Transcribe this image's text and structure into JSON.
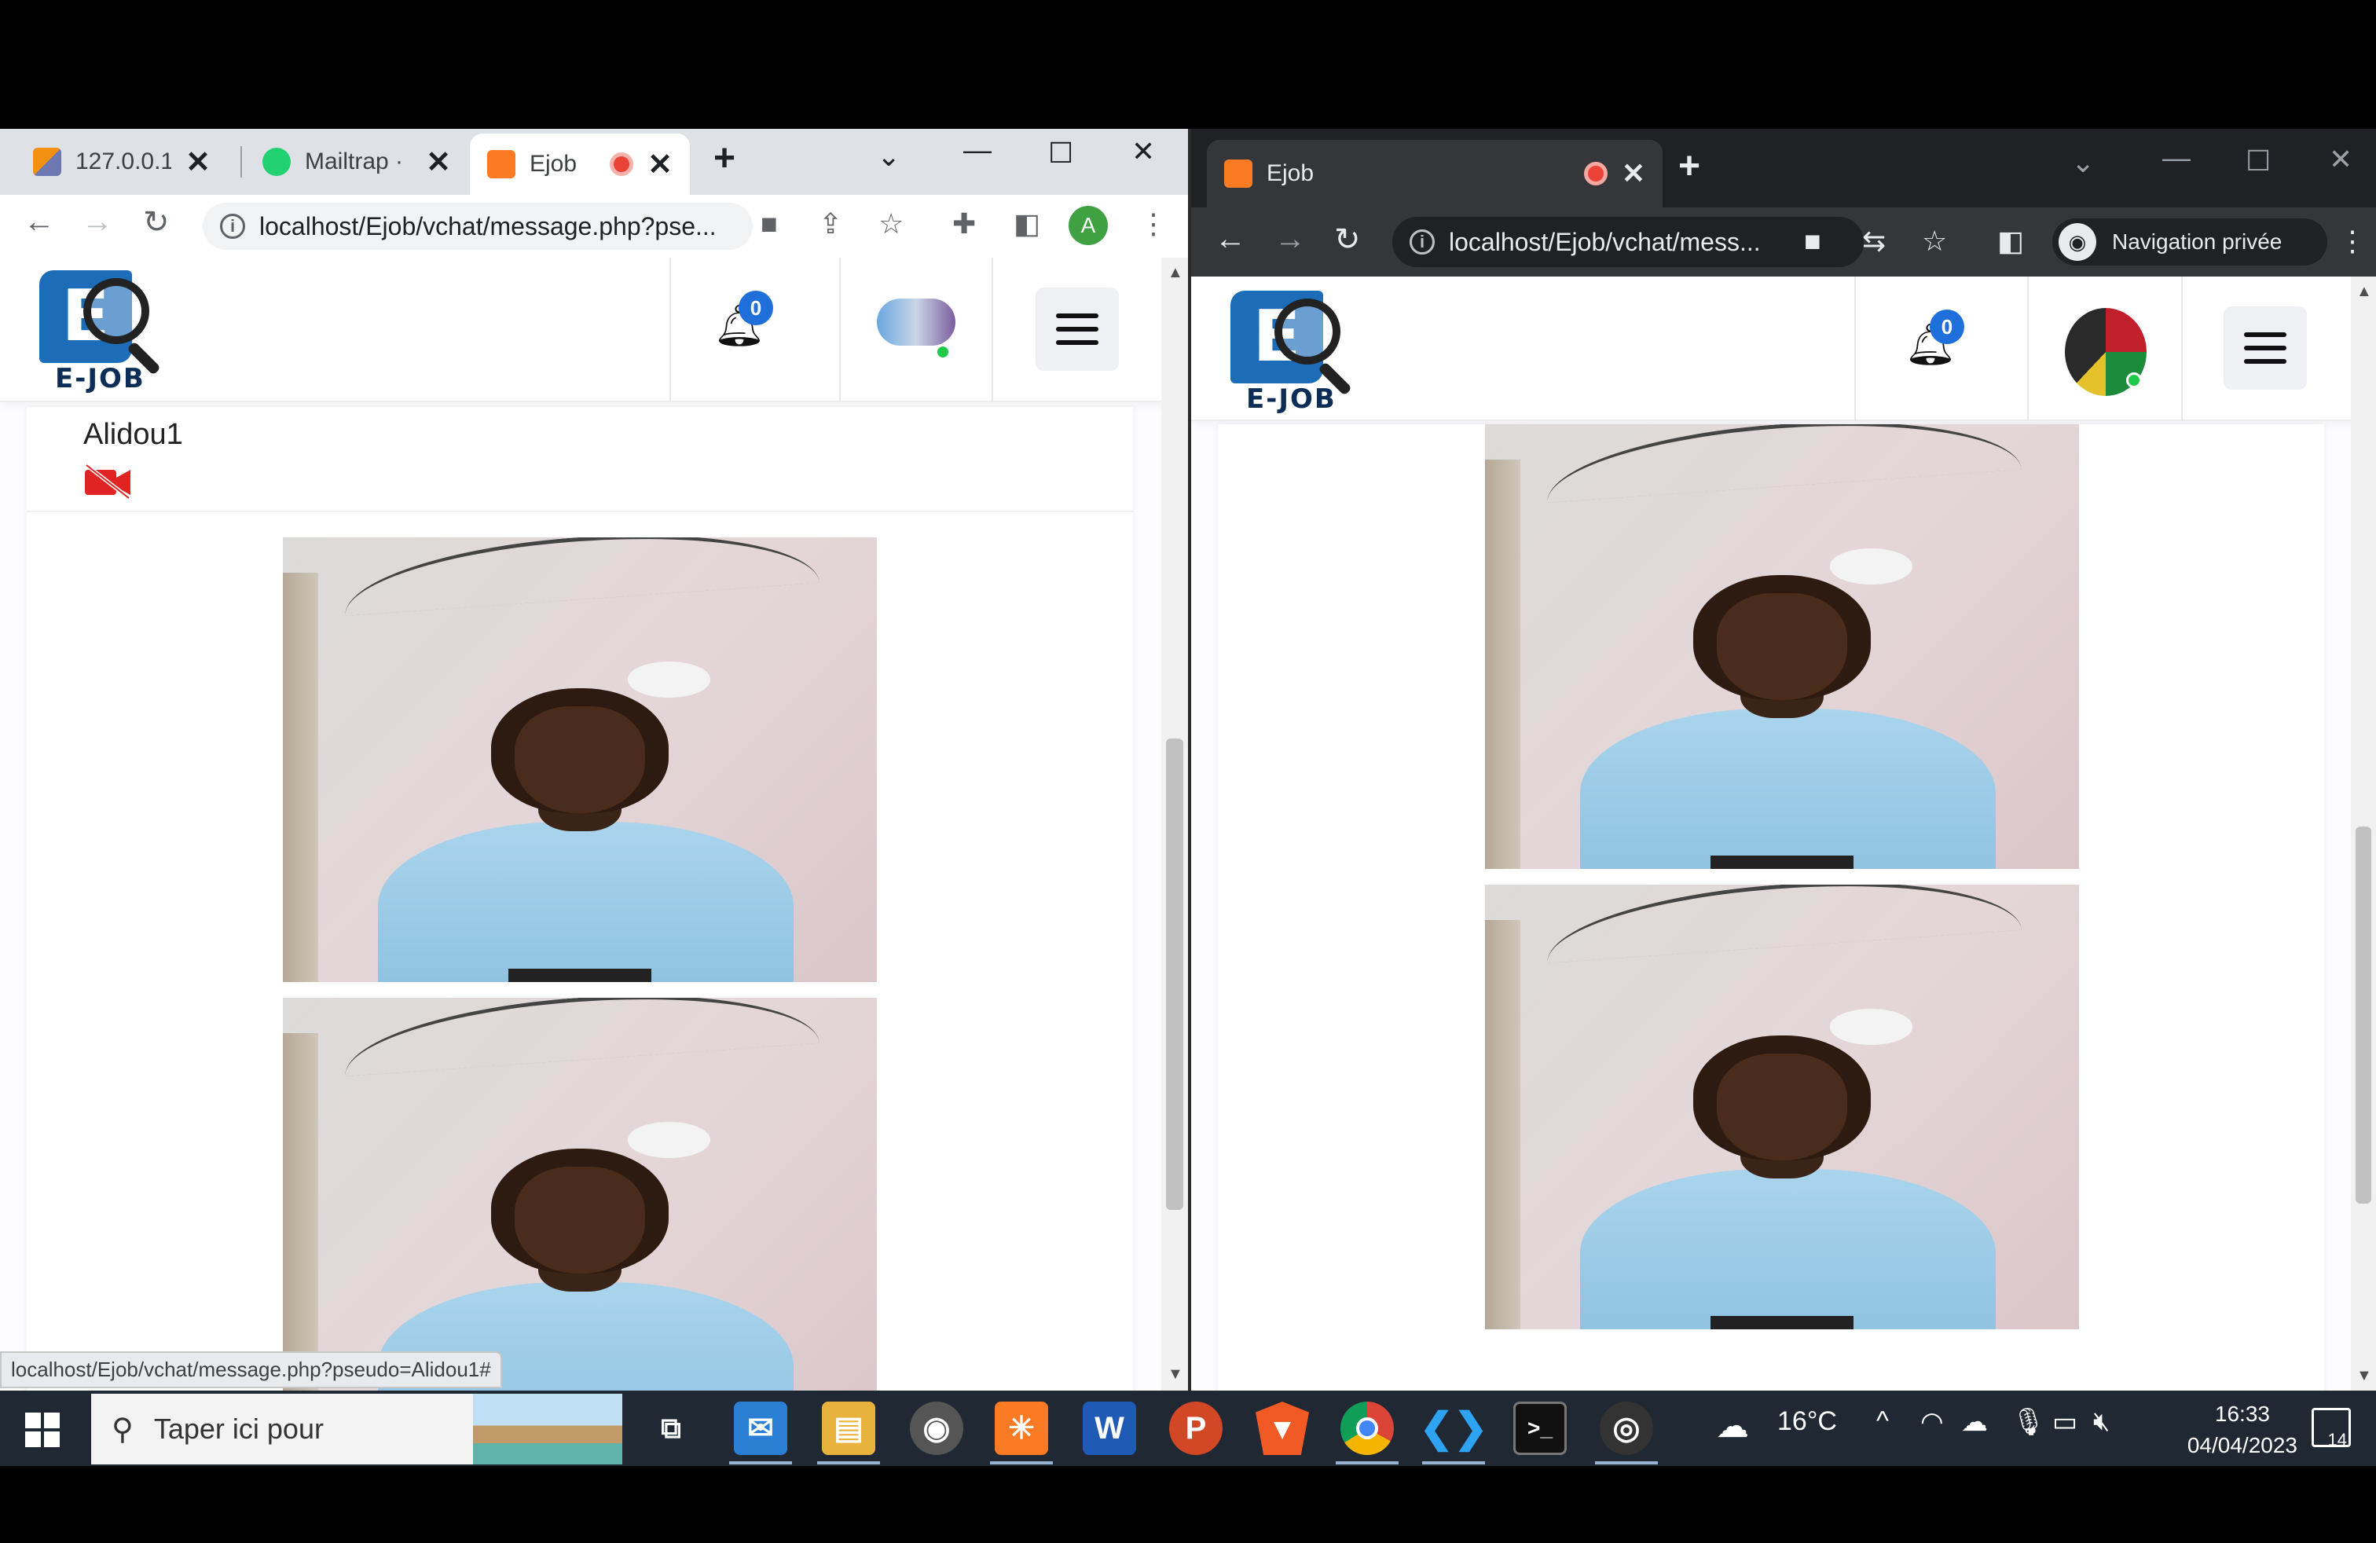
{
  "left_browser": {
    "tabs": [
      {
        "title": "127.0.0.1 /",
        "favicon": "phpmyadmin-icon"
      },
      {
        "title": "Mailtrap ·",
        "favicon": "mailtrap-icon"
      },
      {
        "title": "Ejob",
        "favicon": "xampp-icon",
        "recording": true
      }
    ],
    "url": "localhost/Ejob/vchat/message.php?pse...",
    "profile_initial": "A",
    "status_url": "localhost/Ejob/vchat/message.php?pseudo=Alidou1#"
  },
  "right_browser": {
    "tabs": [
      {
        "title": "Ejob",
        "favicon": "xampp-icon",
        "recording": true
      }
    ],
    "url": "localhost/Ejob/vchat/mess...",
    "incognito_label": "Navigation privée"
  },
  "site": {
    "logo_text": "E-JOB",
    "notification_count": "0",
    "chat_user_name": "Alidou1"
  },
  "taskbar": {
    "search_placeholder": "Taper ici pour",
    "weather": "16°C",
    "time": "16:33",
    "date": "04/04/2023",
    "notification_count": "14"
  },
  "colors": {
    "brand_blue": "#1c6cb8",
    "badge_blue": "#1f6fdb",
    "online_green": "#1ec94c",
    "video_off_red": "#e02424"
  }
}
